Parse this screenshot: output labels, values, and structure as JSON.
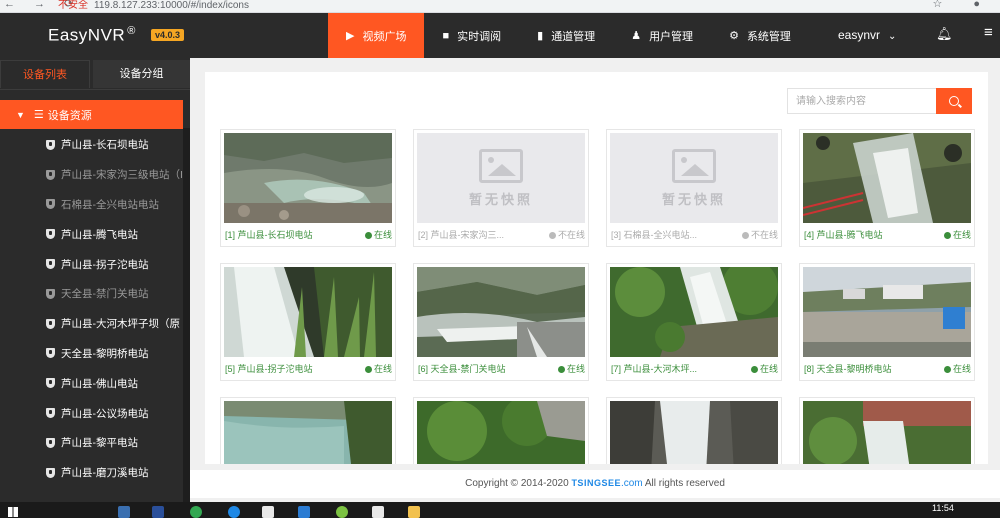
{
  "browser": {
    "security_label": "不安全",
    "url": "119.8.127.233:10000/#/index/icons"
  },
  "header": {
    "logo": "EasyNVR",
    "logo_mark": "®",
    "version": "v4.0.3",
    "menu": [
      {
        "label": "视频广场",
        "icon": "play-icon",
        "active": true
      },
      {
        "label": "实时调阅",
        "icon": "video-camera-icon",
        "active": false
      },
      {
        "label": "通道管理",
        "icon": "channel-icon",
        "active": false
      },
      {
        "label": "用户管理",
        "icon": "user-icon",
        "active": false
      },
      {
        "label": "系统管理",
        "icon": "gear-icon",
        "active": false
      }
    ],
    "username": "easynvr"
  },
  "sidebar": {
    "tabs": [
      "设备列表",
      "设备分组"
    ],
    "root_label": "设备资源",
    "items": [
      {
        "label": "芦山县-长石坝电站",
        "online": true
      },
      {
        "label": "芦山县-宋家沟三级电站（I",
        "online": false
      },
      {
        "label": "石棉县-全兴电站电站",
        "online": false
      },
      {
        "label": "芦山县-腾飞电站",
        "online": true
      },
      {
        "label": "芦山县-拐子沱电站",
        "online": true
      },
      {
        "label": "天全县-禁门关电站",
        "online": false
      },
      {
        "label": "芦山县-大河木坪子坝（原",
        "online": true
      },
      {
        "label": "天全县-黎明桥电站",
        "online": true
      },
      {
        "label": "芦山县-佛山电站",
        "online": true
      },
      {
        "label": "芦山县-公议场电站",
        "online": true
      },
      {
        "label": "芦山县-黎平电站",
        "online": true
      },
      {
        "label": "芦山县-磨刀溪电站",
        "online": true
      }
    ]
  },
  "search": {
    "placeholder": "请输入搜索内容"
  },
  "placeholder_text": "暂无快照",
  "cards": [
    {
      "title": "[1] 芦山县-长石坝电站",
      "status": "在线",
      "online": true,
      "snapshot": "river"
    },
    {
      "title": "[2] 芦山县-宋家沟三...",
      "status": "不在线",
      "online": false,
      "snapshot": "none"
    },
    {
      "title": "[3] 石棉县-全兴电站...",
      "status": "不在线",
      "online": false,
      "snapshot": "none"
    },
    {
      "title": "[4] 芦山县-腾飞电站",
      "status": "在线",
      "online": true,
      "snapshot": "dam-close"
    },
    {
      "title": "[5] 芦山县-拐子沱电站",
      "status": "在线",
      "online": true,
      "snapshot": "waterfall-grass"
    },
    {
      "title": "[6] 天全县-禁门关电站",
      "status": "在线",
      "online": true,
      "snapshot": "river-valley"
    },
    {
      "title": "[7] 芦山县-大河木坪...",
      "status": "在线",
      "online": true,
      "snapshot": "waterfall-vegetation"
    },
    {
      "title": "[8] 天全县-黎明桥电站",
      "status": "在线",
      "online": true,
      "snapshot": "station-buildings"
    },
    {
      "title": "",
      "status": "",
      "online": true,
      "snapshot": "river-blue"
    },
    {
      "title": "",
      "status": "",
      "online": true,
      "snapshot": "jungle"
    },
    {
      "title": "",
      "status": "",
      "online": true,
      "snapshot": "waterfall-rock"
    },
    {
      "title": "",
      "status": "",
      "online": true,
      "snapshot": "waterfall-grass2"
    }
  ],
  "footer": {
    "prefix": "Copyright © 2014-2020",
    "brand": "TSINGSEE",
    "domain": ".com",
    "suffix": "All rights reserved"
  },
  "taskbar": {
    "time": "11:54"
  },
  "colors": {
    "accent": "#ff5722",
    "nav_bg": "#2b2b2b",
    "online_green": "#3b8e3b",
    "version_badge": "#f5a623"
  }
}
